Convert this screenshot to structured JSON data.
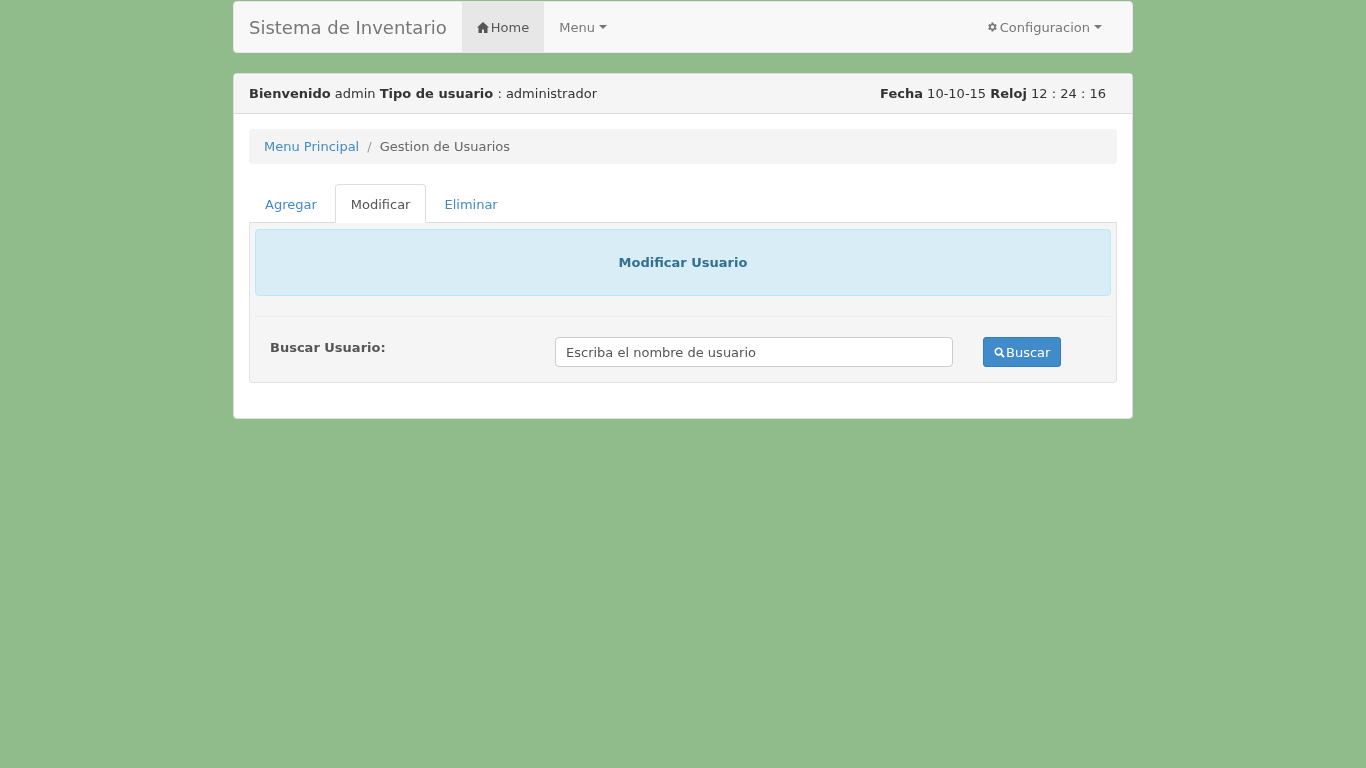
{
  "navbar": {
    "brand": "Sistema de Inventario",
    "items": [
      {
        "label": "Home",
        "kind": "home",
        "selected": true
      },
      {
        "label": "Menu",
        "kind": "dropdown",
        "selected": false
      }
    ],
    "right_items": [
      {
        "label": "Configuracion",
        "kind": "settings",
        "selected": false
      }
    ]
  },
  "panel": {
    "welcome": "**Bienvenido** admin **Tipo de usuario** : administrador",
    "datetime": "**Fecha** 10-10-15 **Reloj** 12 : 24 : 16"
  },
  "breadcrumb": {
    "items": [
      "Menu Principal",
      "Gestion de Usuarios"
    ],
    "separator": "/"
  },
  "tabs": [
    {
      "label": "Agregar",
      "selected": false
    },
    {
      "label": "Modificar",
      "selected": true
    },
    {
      "label": "Eliminar",
      "selected": false
    }
  ],
  "form": {
    "title": "Modificar Usuario",
    "label": "Buscar Usuario:",
    "placeholder": "Escriba el nombre de usuario",
    "button": "Buscar"
  }
}
